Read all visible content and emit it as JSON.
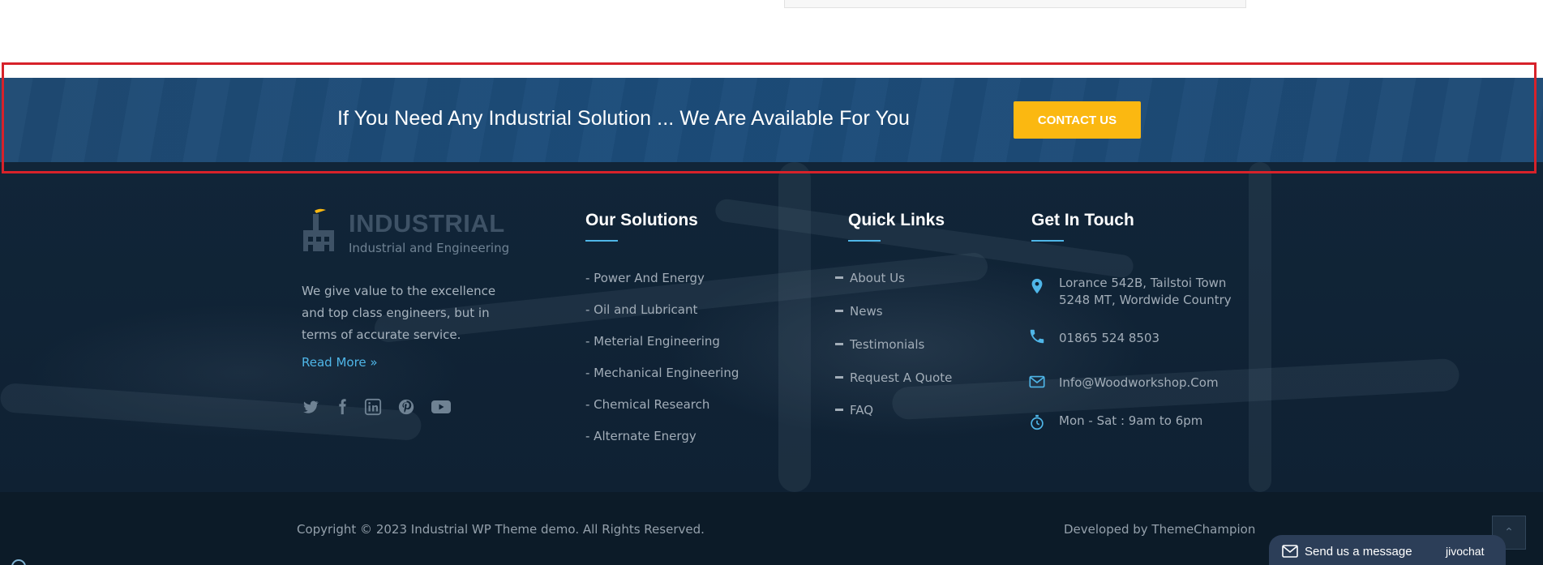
{
  "cta": {
    "text": "If You Need Any Industrial Solution ... We Are Available For You",
    "button_label": "CONTACT US",
    "button_color": "#fbb811",
    "band_color": "#1e4b78"
  },
  "brand": {
    "title": "INDUSTRIAL",
    "subtitle": "Industrial and Engineering",
    "about": "We give value to the excellence and top class engineers, but in terms of accurate service.",
    "read_more": "Read More »",
    "social_icons": [
      "twitter-icon",
      "facebook-icon",
      "linkedin-icon",
      "pinterest-icon",
      "youtube-icon"
    ]
  },
  "solutions": {
    "title": "Our Solutions",
    "items": [
      "- Power And Energy",
      "- Oil and Lubricant",
      "- Meterial Engineering",
      "- Mechanical Engineering",
      "- Chemical Research",
      "- Alternate Energy"
    ]
  },
  "quick_links": {
    "title": "Quick Links",
    "items": [
      "About Us",
      "News",
      "Testimonials",
      "Request A Quote",
      "FAQ"
    ]
  },
  "contact": {
    "title": "Get In Touch",
    "address_line1": "Lorance 542B, Tailstoi Town",
    "address_line2": "5248 MT, Wordwide Country",
    "phone": "01865 524 8503",
    "email": "Info@Woodworkshop.Com",
    "hours": "Mon - Sat : 9am to 6pm",
    "accent_color": "#4fb6e8"
  },
  "footer_bottom": {
    "copyright": "Copyright © 2023 Industrial WP Theme demo. All Rights Reserved.",
    "developed": "Developed by ThemeChampion"
  },
  "chat": {
    "label": "Send us a message",
    "brand": "jivochat"
  },
  "scroll_top_glyph": "⌃"
}
